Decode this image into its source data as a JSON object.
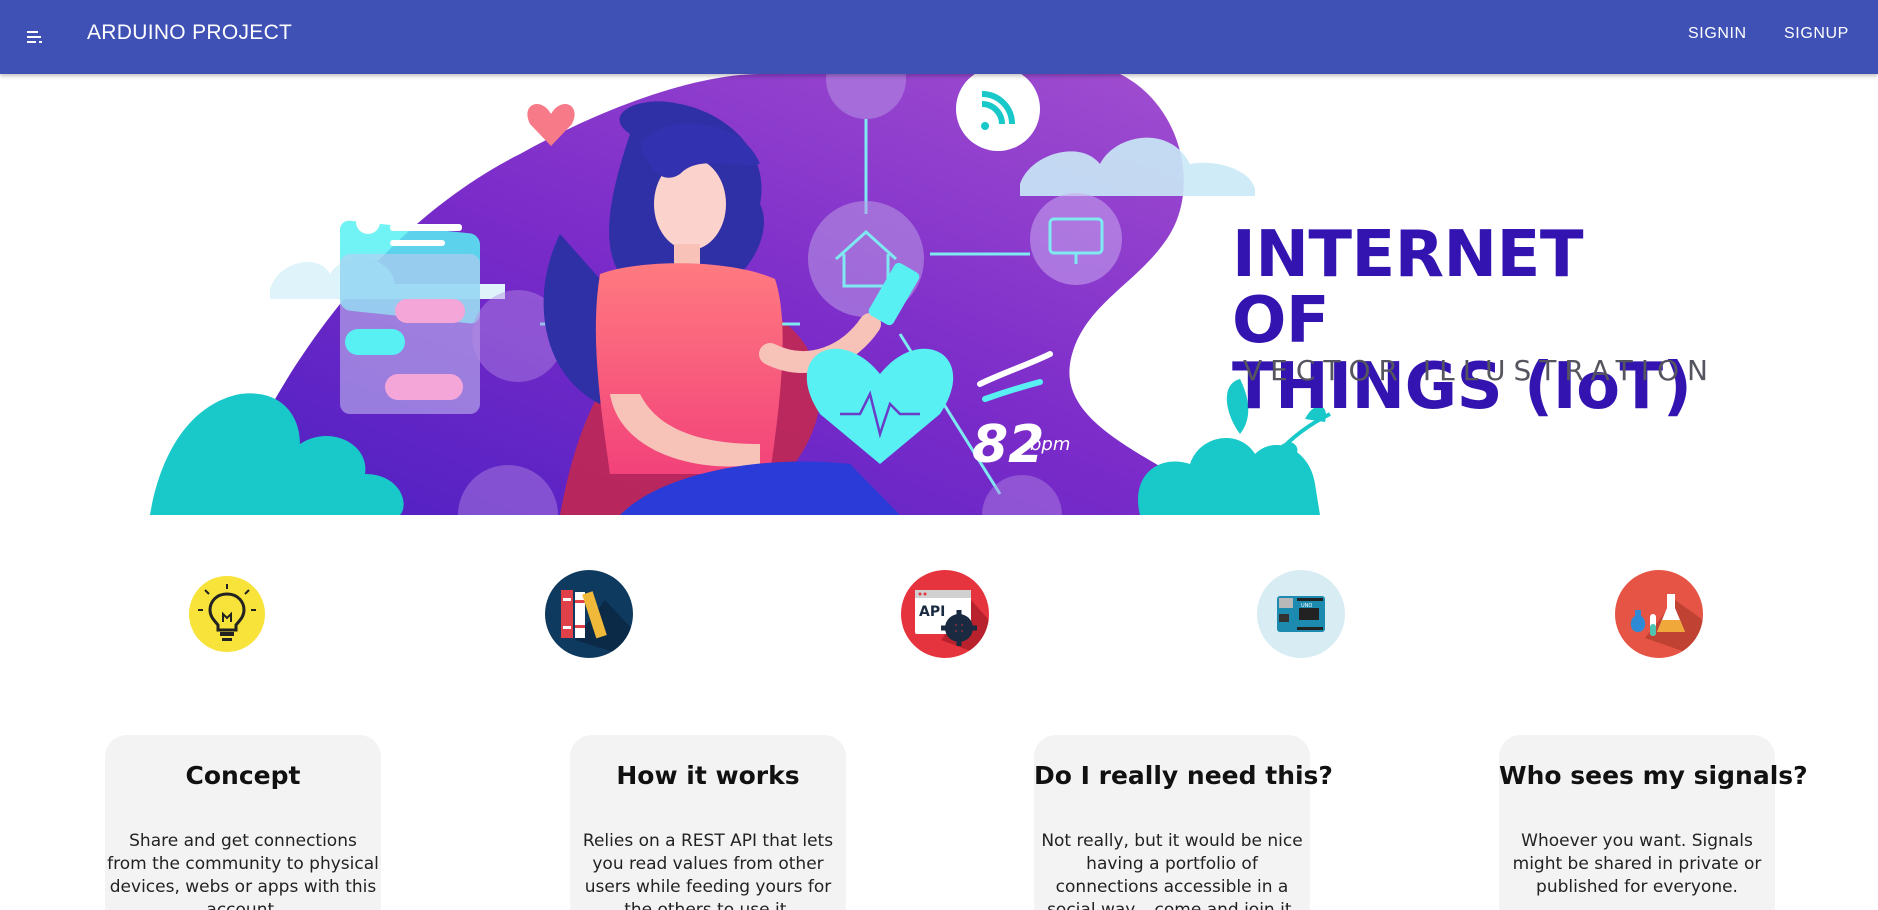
{
  "appbar": {
    "title": "ARDUINO PROJECT",
    "signin_label": "SIGNIN",
    "signup_label": "SIGNUP",
    "color": "#3f51b5"
  },
  "hero": {
    "title_line1": "INTERNET OF",
    "title_line2": "THINGS (IoT)",
    "subtitle": "VECTOR ILLUSTRATION",
    "bpm_value": "82",
    "bpm_unit": "bpm"
  },
  "feature_icons": [
    {
      "name": "lightbulb-icon",
      "bg": "#f7e33a"
    },
    {
      "name": "books-icon",
      "bg": "#0f3a5f"
    },
    {
      "name": "api-gear-icon",
      "bg": "#e6343f"
    },
    {
      "name": "arduino-board-icon",
      "bg": "#d8ecf3"
    },
    {
      "name": "lab-flasks-icon",
      "bg": "#e55444"
    }
  ],
  "cards": [
    {
      "title": "Concept",
      "text": "Share and get connections from the community to physical devices, webs or apps with this account."
    },
    {
      "title": "How it works",
      "text": "Relies on a REST API that lets you read values from other users while feeding yours for the others to use it."
    },
    {
      "title": "Do I really need this?",
      "text": "Not really, but it would be nice having a portfolio of connections accessible in a social way... come and join it."
    },
    {
      "title": "Who sees my signals?",
      "text": "Whoever you want. Signals might be shared in private or published for everyone."
    }
  ]
}
